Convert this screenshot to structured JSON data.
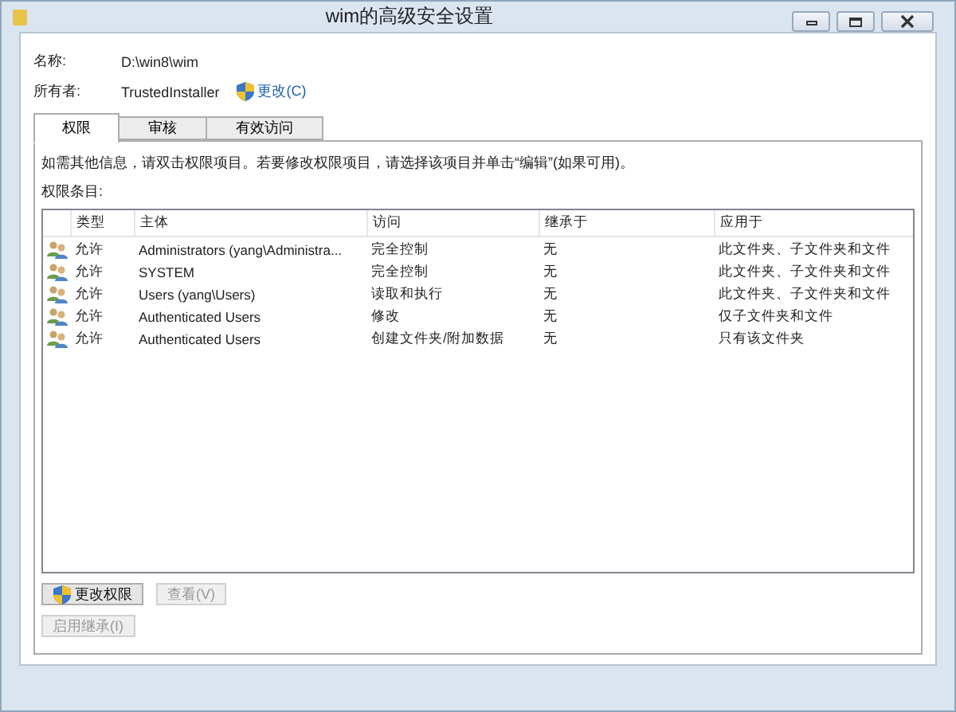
{
  "window": {
    "title": "wim的高级安全设置"
  },
  "name": {
    "label": "名称:",
    "value": "D:\\win8\\wim"
  },
  "owner": {
    "label": "所有者:",
    "value": "TrustedInstaller",
    "change_link": "更改(C)"
  },
  "tabs": [
    {
      "label": "权限",
      "selected": true
    },
    {
      "label": "审核",
      "selected": false
    },
    {
      "label": "有效访问",
      "selected": false
    }
  ],
  "info": "如需其他信息，请双击权限项目。若要修改权限项目，请选择该项目并单击“编辑”(如果可用)。",
  "list_label": "权限条目:",
  "table": {
    "columns": [
      "类型",
      "主体",
      "访问",
      "继承于",
      "应用于"
    ],
    "rows": [
      {
        "cells": [
          "允许",
          "Administrators (yang\\Administra...",
          "完全控制",
          "无",
          "此文件夹、子文件夹和文件"
        ]
      },
      {
        "cells": [
          "允许",
          "SYSTEM",
          "完全控制",
          "无",
          "此文件夹、子文件夹和文件"
        ]
      },
      {
        "cells": [
          "允许",
          "Users (yang\\Users)",
          "读取和执行",
          "无",
          "此文件夹、子文件夹和文件"
        ]
      },
      {
        "cells": [
          "允许",
          "Authenticated Users",
          "修改",
          "无",
          "仅子文件夹和文件"
        ]
      },
      {
        "cells": [
          "允许",
          "Authenticated Users",
          "创建文件夹/附加数据",
          "无",
          "只有该文件夹"
        ]
      }
    ]
  },
  "buttons": [
    {
      "label": "更改权限",
      "kind": "shield",
      "disabled": false
    },
    {
      "label": "查看(V)",
      "kind": "plain",
      "disabled": true
    }
  ],
  "inherit_button": {
    "label": "启用继承(I)",
    "disabled": true
  }
}
